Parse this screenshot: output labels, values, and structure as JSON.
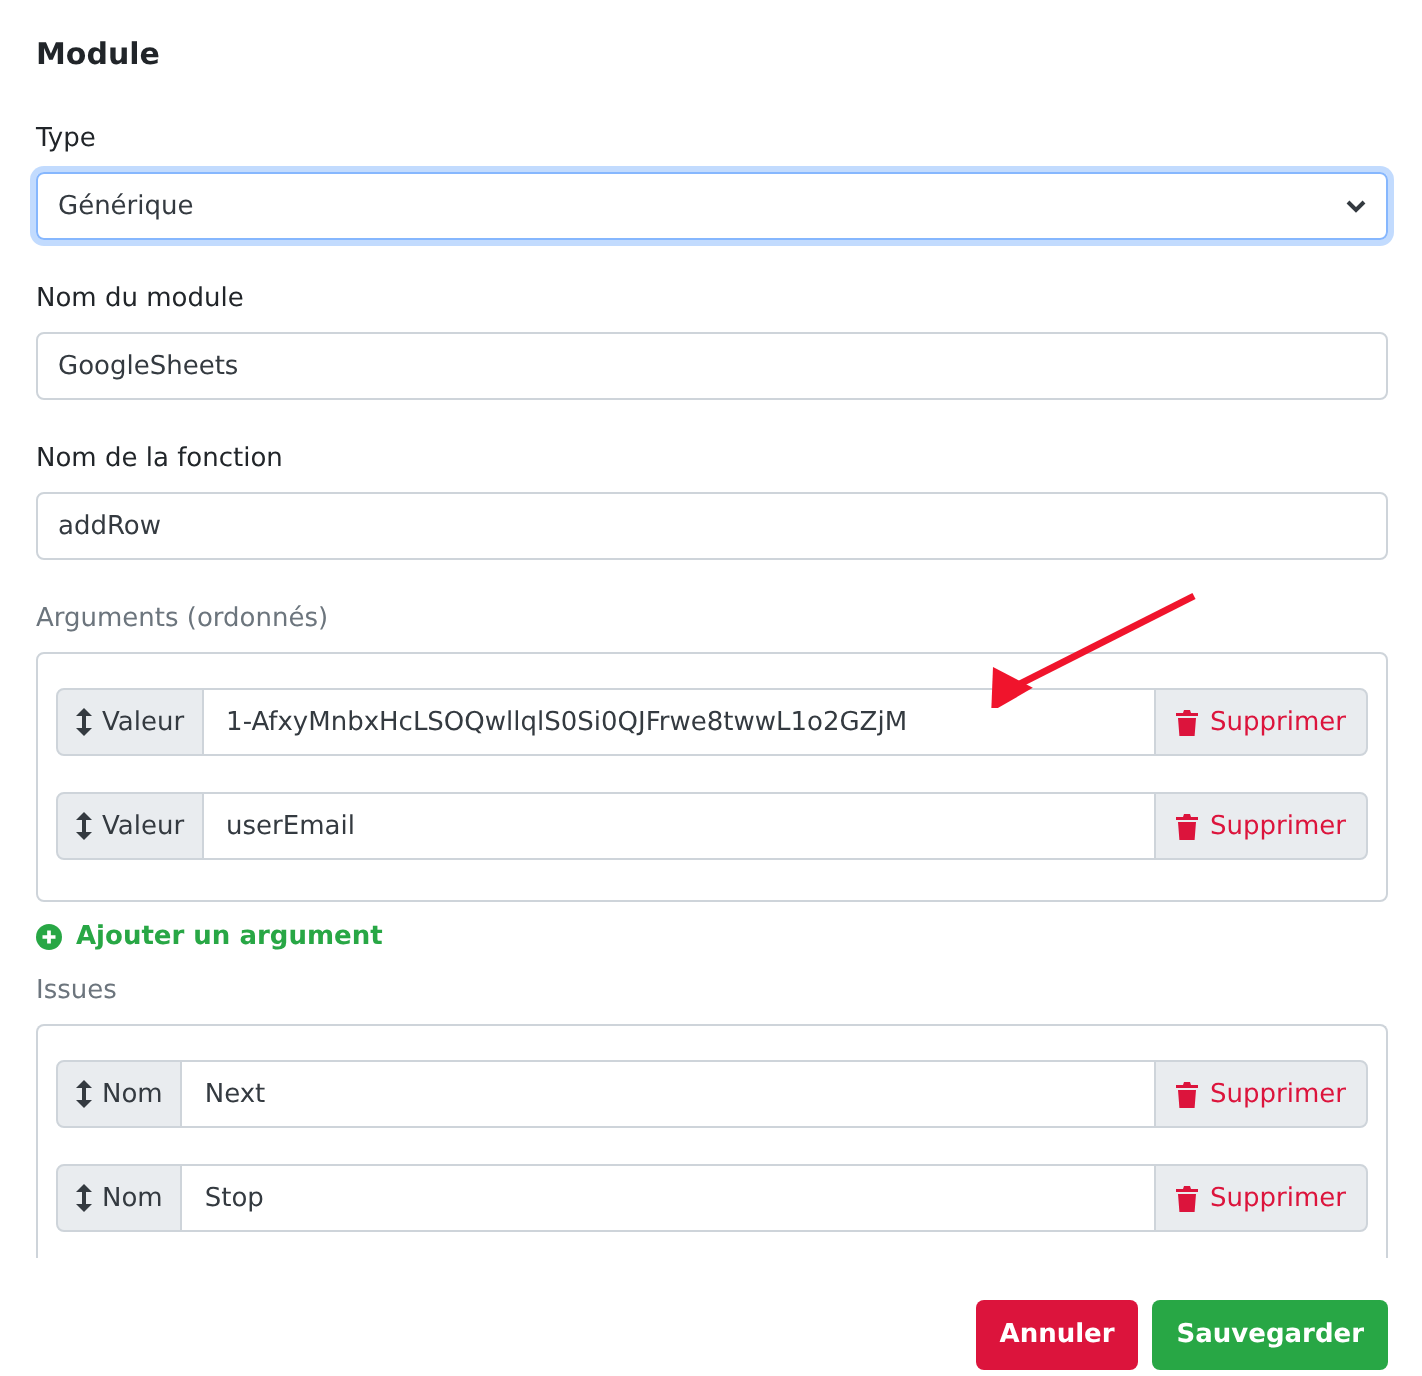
{
  "title": "Module",
  "type_field": {
    "label": "Type",
    "value": "Générique",
    "focused": true
  },
  "module_name": {
    "label": "Nom du module",
    "value": "GoogleSheets"
  },
  "function_name": {
    "label": "Nom de la fonction",
    "value": "addRow"
  },
  "arguments": {
    "label": "Arguments (ordonnés)",
    "rows": [
      {
        "tag": "Valeur",
        "value": "1-AfxyMnbxHcLSOQwllqlS0Si0QJFrwe8twwL1o2GZjM",
        "action": "Supprimer"
      },
      {
        "tag": "Valeur",
        "value": "userEmail",
        "action": "Supprimer"
      }
    ],
    "add_link": "Ajouter un argument"
  },
  "issues": {
    "label": "Issues",
    "rows": [
      {
        "tag": "Nom",
        "value": "Next",
        "action": "Supprimer"
      },
      {
        "tag": "Nom",
        "value": "Stop",
        "action": "Supprimer"
      }
    ]
  },
  "buttons": [
    {
      "label": "Annuler",
      "kind": "danger"
    },
    {
      "label": "Sauvegarder",
      "kind": "success"
    }
  ]
}
